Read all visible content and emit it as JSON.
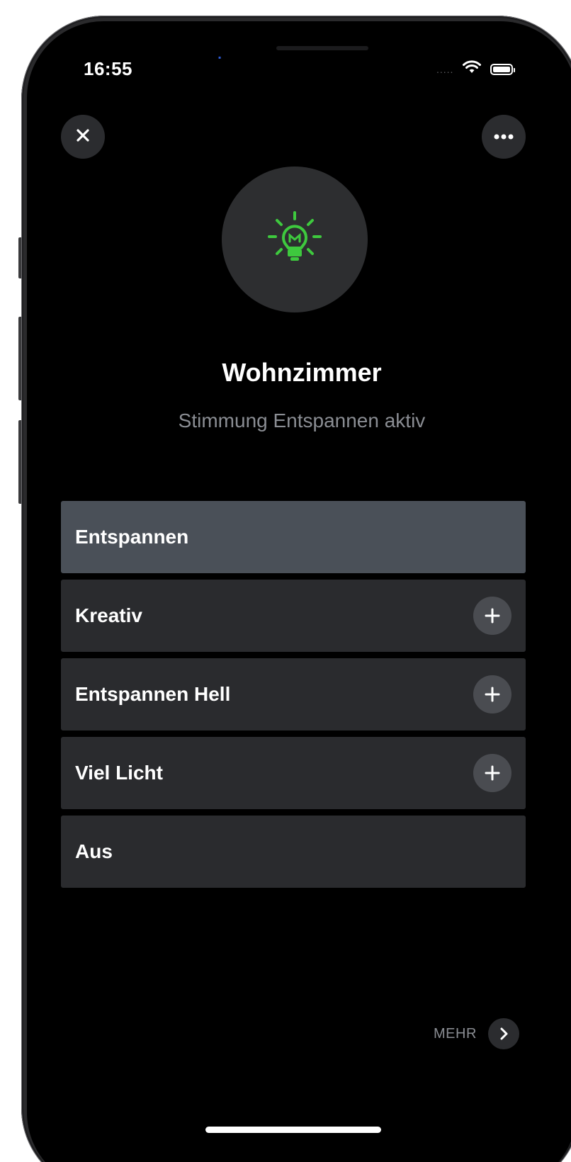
{
  "status_bar": {
    "time": "16:55",
    "signal": "....."
  },
  "header": {
    "close_icon": "close-icon",
    "more_icon": "more-dots-icon"
  },
  "hero": {
    "icon": "lightbulb-icon",
    "icon_color": "#3ec93e"
  },
  "room": {
    "title": "Wohnzimmer",
    "subtitle": "Stimmung Entspannen aktiv"
  },
  "scenes": [
    {
      "label": "Entspannen",
      "active": true,
      "has_add": false
    },
    {
      "label": "Kreativ",
      "active": false,
      "has_add": true
    },
    {
      "label": "Entspannen Hell",
      "active": false,
      "has_add": true
    },
    {
      "label": "Viel Licht",
      "active": false,
      "has_add": true
    },
    {
      "label": "Aus",
      "active": false,
      "has_add": false
    }
  ],
  "footer": {
    "more_label": "MEHR",
    "more_icon": "chevron-right-icon"
  },
  "colors": {
    "background": "#000000",
    "card": "#2a2b2e",
    "card_active": "#4a5058",
    "accent_green": "#3ec93e",
    "muted_text": "#8a8d93"
  }
}
